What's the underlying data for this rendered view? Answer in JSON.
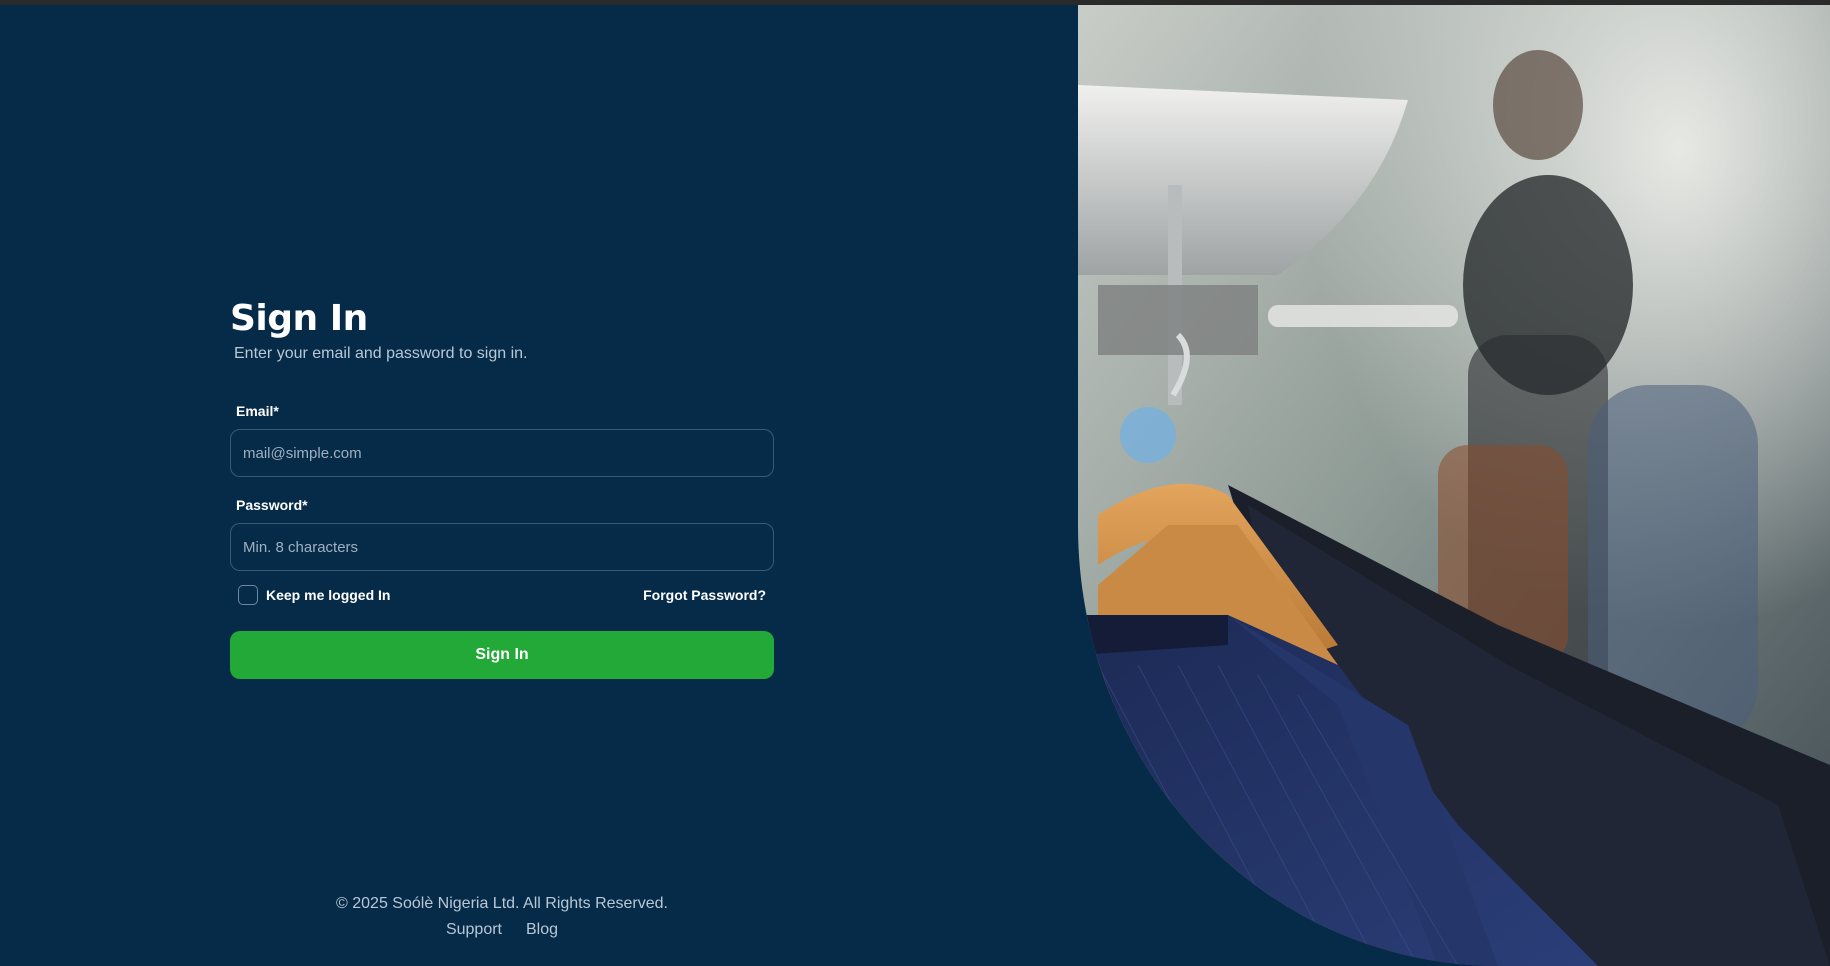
{
  "signin": {
    "title": "Sign In",
    "subtitle": "Enter your email and password to sign in.",
    "email_label": "Email*",
    "email_placeholder": "mail@simple.com",
    "email_value": "",
    "password_label": "Password*",
    "password_placeholder": "Min. 8 characters",
    "password_value": "",
    "remember_label": "Keep me logged In",
    "remember_checked": false,
    "forgot_label": "Forgot Password?",
    "submit_label": "Sign In"
  },
  "footer": {
    "copyright": "© 2025 Soólè Nigeria Ltd. All Rights Reserved.",
    "links": [
      "Support",
      "Blog"
    ]
  },
  "theme": {
    "background": "#062b48",
    "accent": "#23a938",
    "muted_text": "#b8c7d6"
  },
  "hero_image": {
    "icon": "clothing-rack-photo"
  }
}
